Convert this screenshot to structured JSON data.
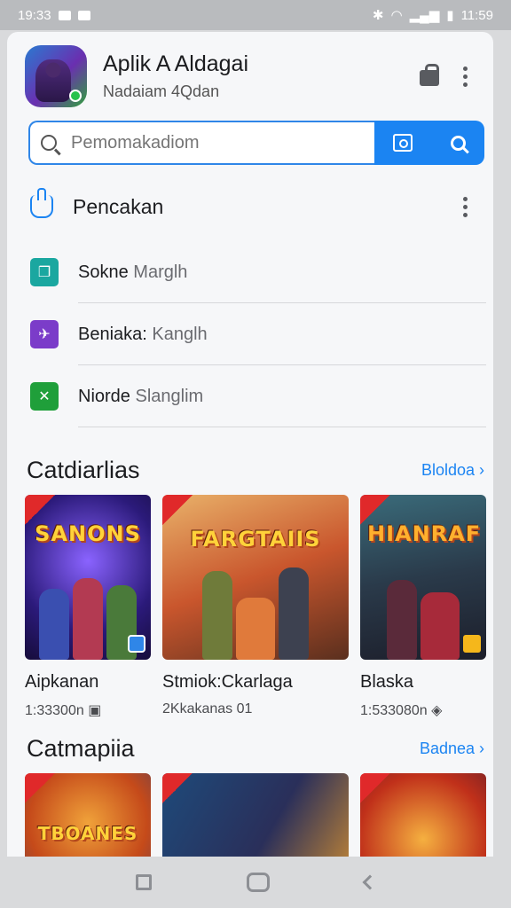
{
  "status_bar": {
    "time": "19:33",
    "battery_time": "11:59"
  },
  "app": {
    "title": "Aplik A Aldagai",
    "subtitle": "Nadaiam 4Qdan"
  },
  "search": {
    "placeholder": "Pemomakadiom"
  },
  "section": {
    "title": "Pencakan"
  },
  "list": [
    {
      "label": "Sokne",
      "sub": "Marglh",
      "icon": "copy-icon",
      "color": "#1aa7a0"
    },
    {
      "label": "Beniaka:",
      "sub": "Kanglh",
      "icon": "plane-icon",
      "color": "#7b3cc9"
    },
    {
      "label": "Niorde",
      "sub": "Slanglim",
      "icon": "close-x-icon",
      "color": "#1f9f3a"
    }
  ],
  "categories": [
    {
      "title": "Catdiarlias",
      "more": "Bloldoa",
      "cards": [
        {
          "title": "Aipkanan",
          "meta": "1:33300n",
          "cover": "SANONS"
        },
        {
          "title": "Stmiok:Ckarlaga",
          "meta": "2Kkakanas 01",
          "cover": "FARGTAIIS"
        },
        {
          "title": "Blaska",
          "meta": "1:533080n",
          "cover": "HIANRAF"
        }
      ]
    },
    {
      "title": "Catmapiia",
      "more": "Badnea",
      "cards": [
        {
          "cover": "TBOANES"
        },
        {
          "cover": ""
        },
        {
          "cover": ""
        }
      ]
    }
  ],
  "colors": {
    "accent": "#1b84f2"
  }
}
